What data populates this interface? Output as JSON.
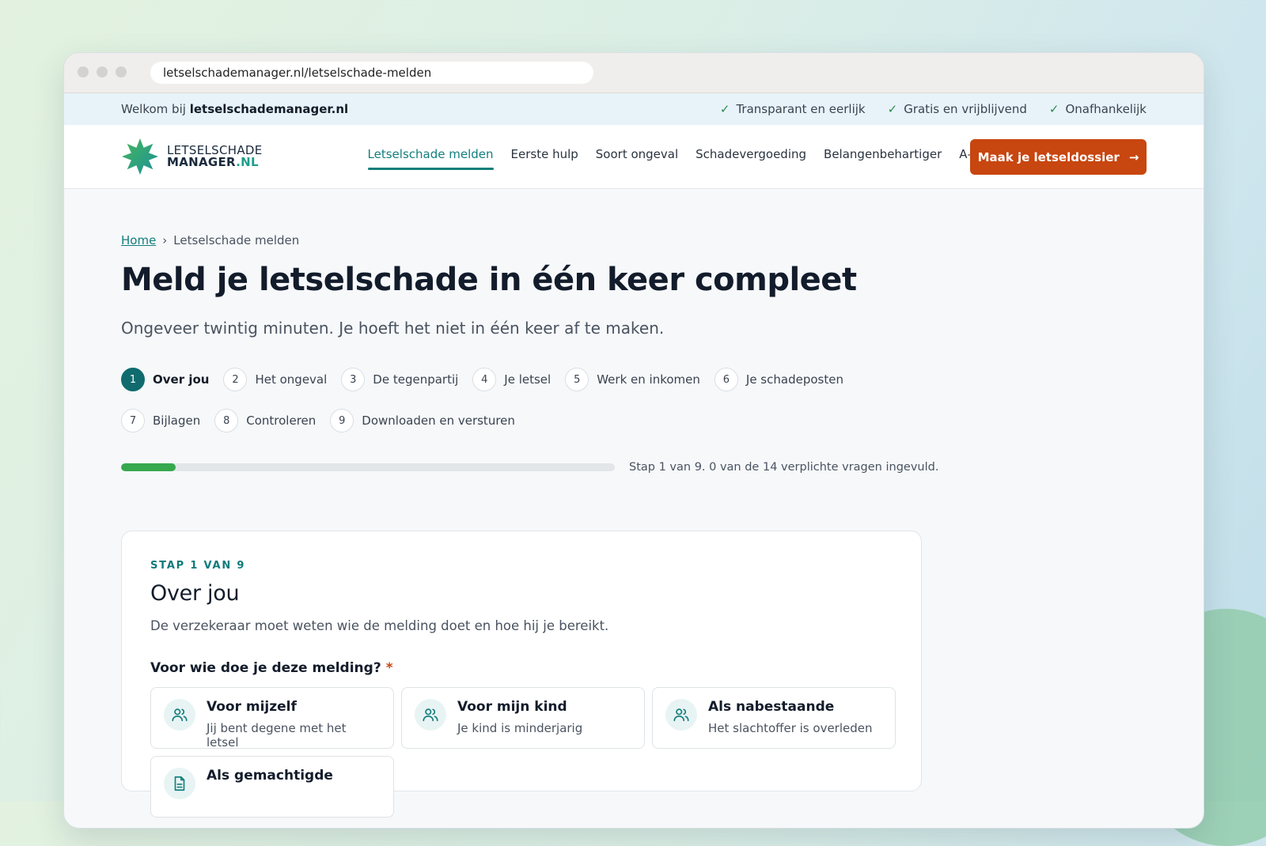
{
  "browser": {
    "url": "letselschademanager.nl/letselschade-melden"
  },
  "topbar": {
    "welcome_prefix": "Welkom bij",
    "welcome_site": "letselschademanager.nl",
    "usps": [
      "Transparant en eerlijk",
      "Gratis en vrijblijvend",
      "Onafhankelijk"
    ]
  },
  "logo": {
    "line1": "LETSELSCHADE",
    "line2_main": "MANAGER",
    "line2_suffix": ".NL"
  },
  "nav": {
    "items": [
      "Letselschade melden",
      "Eerste hulp",
      "Soort ongeval",
      "Schadevergoeding",
      "Belangenbehartiger",
      "A–Z"
    ],
    "active_index": 0,
    "cta_label": "Maak je letseldossier"
  },
  "breadcrumb": {
    "home": "Home",
    "separator": "›",
    "current": "Letselschade melden"
  },
  "page": {
    "title": "Meld je letselschade in één keer compleet",
    "subtitle": "Ongeveer twintig minuten. Je hoeft het niet in één keer af te maken."
  },
  "steps": [
    {
      "num": "1",
      "label": "Over jou",
      "active": true
    },
    {
      "num": "2",
      "label": "Het ongeval"
    },
    {
      "num": "3",
      "label": "De tegenpartij"
    },
    {
      "num": "4",
      "label": "Je letsel"
    },
    {
      "num": "5",
      "label": "Werk en inkomen"
    },
    {
      "num": "6",
      "label": "Je schadeposten"
    },
    {
      "num": "7",
      "label": "Bijlagen"
    },
    {
      "num": "8",
      "label": "Controleren"
    },
    {
      "num": "9",
      "label": "Downloaden en versturen"
    }
  ],
  "progress": {
    "fraction": 0.11,
    "text": "Stap 1 van 9. 0 van de 14 verplichte vragen ingevuld."
  },
  "card": {
    "eyebrow": "STAP 1 VAN 9",
    "title": "Over jou",
    "description": "De verzekeraar moet weten wie de melding doet en hoe hij je bereikt.",
    "question": "Voor wie doe je deze melding?",
    "required_mark": "*",
    "options": [
      {
        "title": "Voor mijzelf",
        "subtitle": "Jij bent degene met het letsel",
        "icon": "people-icon"
      },
      {
        "title": "Voor mijn kind",
        "subtitle": "Je kind is minderjarig",
        "icon": "people-icon"
      },
      {
        "title": "Als nabestaande",
        "subtitle": "Het slachtoffer is overleden",
        "icon": "people-icon"
      },
      {
        "title": "Als gemachtigde",
        "subtitle": "",
        "icon": "document-icon"
      }
    ]
  },
  "colors": {
    "brand_teal": "#0f6b6e",
    "cta_orange": "#c8460f",
    "progress_green": "#36a84d"
  }
}
